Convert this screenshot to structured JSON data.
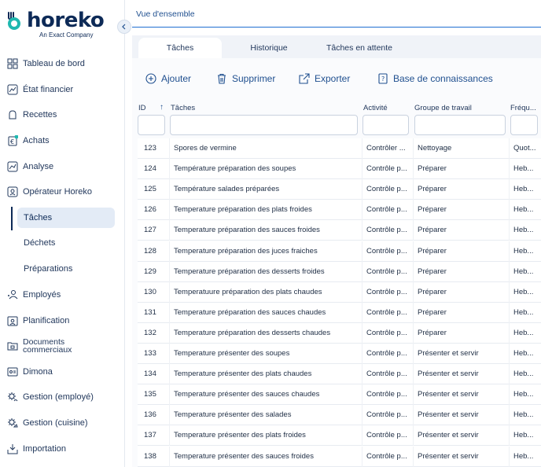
{
  "brand": {
    "name": "horeko",
    "subtitle": "An Exact Company"
  },
  "sidebar": {
    "items": [
      {
        "label": "Tableau de bord",
        "icon": "dashboard-icon"
      },
      {
        "label": "État financier",
        "icon": "finance-icon"
      },
      {
        "label": "Recettes",
        "icon": "recipes-icon"
      },
      {
        "label": "Achats",
        "icon": "purchases-icon"
      },
      {
        "label": "Analyse",
        "icon": "analysis-icon"
      },
      {
        "label": "Opérateur Horeko",
        "icon": "operator-icon"
      },
      {
        "label": "Employés",
        "icon": "employees-icon"
      },
      {
        "label": "Planification",
        "icon": "planning-icon"
      },
      {
        "label": "Documents commerciaux",
        "icon": "documents-icon"
      },
      {
        "label": "Dimona",
        "icon": "dimona-icon"
      },
      {
        "label": "Gestion (employé)",
        "icon": "gear-icon"
      },
      {
        "label": "Gestion (cuisine)",
        "icon": "gear-icon"
      },
      {
        "label": "Importation",
        "icon": "import-icon"
      }
    ],
    "subitems": [
      {
        "label": "Tâches",
        "active": true
      },
      {
        "label": "Déchets",
        "active": false
      },
      {
        "label": "Préparations",
        "active": false
      }
    ]
  },
  "breadcrumb": "Vue d'ensemble",
  "tabs": [
    {
      "label": "Tâches",
      "active": true
    },
    {
      "label": "Historique",
      "active": false
    },
    {
      "label": "Tâches en attente",
      "active": false
    }
  ],
  "toolbar": {
    "add": "Ajouter",
    "delete": "Supprimer",
    "export": "Exporter",
    "knowledge": "Base de connaissances"
  },
  "table": {
    "columns": [
      "ID",
      "Tâches",
      "Activité",
      "Groupe de travail",
      "Fréqu..."
    ],
    "rows": [
      [
        "123",
        "Spores de vermine",
        "Contrôler ...",
        "Nettoyage",
        "Quot..."
      ],
      [
        "124",
        "Température préparation des soupes",
        "Contrôle p...",
        "Préparer",
        "Heb..."
      ],
      [
        "125",
        "Température salades préparées",
        "Contrôle p...",
        "Préparer",
        "Heb..."
      ],
      [
        "126",
        "Temperature préparation des plats froides",
        "Contrôle p...",
        "Préparer",
        "Heb..."
      ],
      [
        "127",
        "Temperature préparation des sauces froides",
        "Contrôle p...",
        "Préparer",
        "Heb..."
      ],
      [
        "128",
        "Temperature préparation des juces fraiches",
        "Contrôle p...",
        "Préparer",
        "Heb..."
      ],
      [
        "129",
        "Temperature préparation des desserts froides",
        "Contrôle p...",
        "Préparer",
        "Heb..."
      ],
      [
        "130",
        "Temperatuure préparation des plats chaudes",
        "Contrôle p...",
        "Préparer",
        "Heb..."
      ],
      [
        "131",
        "Temperature préparation des sauces chaudes",
        "Contrôle p...",
        "Préparer",
        "Heb..."
      ],
      [
        "132",
        "Temperature préparation des desserts chaudes",
        "Contrôle p...",
        "Préparer",
        "Heb..."
      ],
      [
        "133",
        "Temperature présenter des soupes",
        "Contrôle p...",
        "Présenter et servir",
        "Heb..."
      ],
      [
        "134",
        "Temperature présenter des plats chaudes",
        "Contrôle p...",
        "Présenter et servir",
        "Heb..."
      ],
      [
        "135",
        "Temperature présenter des sauces chaudes",
        "Contrôle p...",
        "Présenter et servir",
        "Heb..."
      ],
      [
        "136",
        "Temperature présenter des salades",
        "Contrôle p...",
        "Présenter et servir",
        "Heb..."
      ],
      [
        "137",
        "Temperature présenter des plats froides",
        "Contrôle p...",
        "Présenter et servir",
        "Heb..."
      ],
      [
        "138",
        "Temperature présenter des sauces froides",
        "Contrôle p...",
        "Présenter et servir",
        "Heb..."
      ]
    ]
  },
  "colors": {
    "brand": "#0d2a57",
    "accent": "#1f6fd1",
    "logo_teal": "#1fb8b0"
  }
}
